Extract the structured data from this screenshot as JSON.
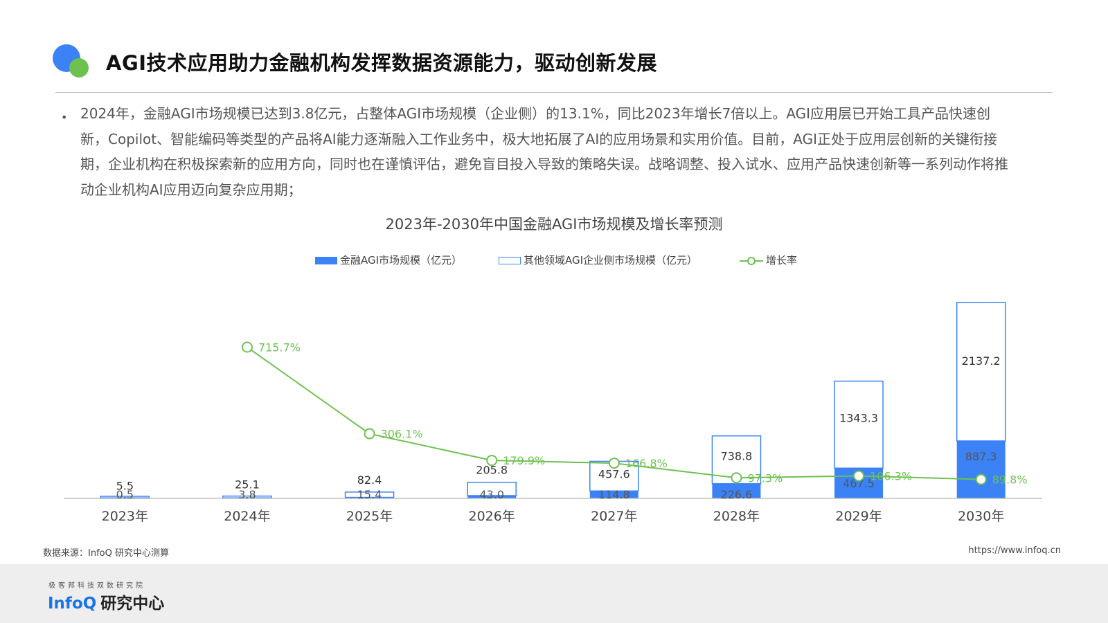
{
  "header": {
    "title": "AGI技术应用助力金融机构发挥数据资源能力，驱动创新发展"
  },
  "bullet": {
    "symbol": "•",
    "text": "2024年，金融AGI市场规模已达到3.8亿元，占整体AGI市场规模（企业侧）的13.1%，同比2023年增长7倍以上。AGI应用层已开始工具产品快速创新，Copilot、智能编码等类型的产品将AI能力逐渐融入工作业务中，极大地拓展了AI的应用场景和实用价值。目前，AGI正处于应用层创新的关键衔接期，企业机构在积极探索新的应用方向，同时也在谨慎评估，避免盲目投入导致的策略失误。战略调整、投入试水、应用产品快速创新等一系列动作将推动企业机构AI应用迈向复杂应用期；"
  },
  "chart_data": {
    "type": "bar",
    "title": "2023年-2030年中国金融AGI市场规模及增长率预测",
    "categories": [
      "2023年",
      "2024年",
      "2025年",
      "2026年",
      "2027年",
      "2028年",
      "2029年",
      "2030年"
    ],
    "series": [
      {
        "name": "金融AGI市场规模（亿元）",
        "kind": "bar-filled",
        "values": [
          0.5,
          3.8,
          15.4,
          43.0,
          114.8,
          226.6,
          467.5,
          887.3
        ],
        "labels": [
          "0.5",
          "3.8",
          "15.4",
          "43.0",
          "114.8",
          "226.6",
          "467.5",
          "887.3"
        ]
      },
      {
        "name": "其他领域AGI企业侧市场规模（亿元）",
        "kind": "bar-outline-stacked",
        "values": [
          5.5,
          25.1,
          82.4,
          205.8,
          457.6,
          738.8,
          1343.3,
          2137.2
        ],
        "labels": [
          "5.5",
          "25.1",
          "82.4",
          "205.8",
          "457.6",
          "738.8",
          "1343.3",
          "2137.2"
        ]
      },
      {
        "name": "增长率",
        "kind": "line",
        "values": [
          null,
          715.7,
          306.1,
          179.9,
          166.8,
          97.3,
          106.3,
          89.8
        ],
        "labels": [
          "",
          "715.7%",
          "306.1%",
          "179.9%",
          "166.8%",
          "97.3%",
          "106.3%",
          "89.8%"
        ]
      }
    ],
    "ylim": [
      0,
      3100
    ],
    "y2lim": [
      0,
      950
    ],
    "legend_position": "top-center",
    "grid": false
  },
  "footer": {
    "source": "数据来源：InfoQ 研究中心测算",
    "url": "https://www.infoq.cn",
    "brand_sub": "极客邦科技双数研究院",
    "brand_infoq": "InfoQ",
    "brand_rest": "研究中心"
  },
  "colors": {
    "bar_fill": "#3b82f6",
    "bar_outline": "#3b82f6",
    "line": "#6dc14f",
    "axis": "#bfbfbf",
    "title_dot_blue": "#3b82f6",
    "title_dot_green": "#6dc14f"
  }
}
